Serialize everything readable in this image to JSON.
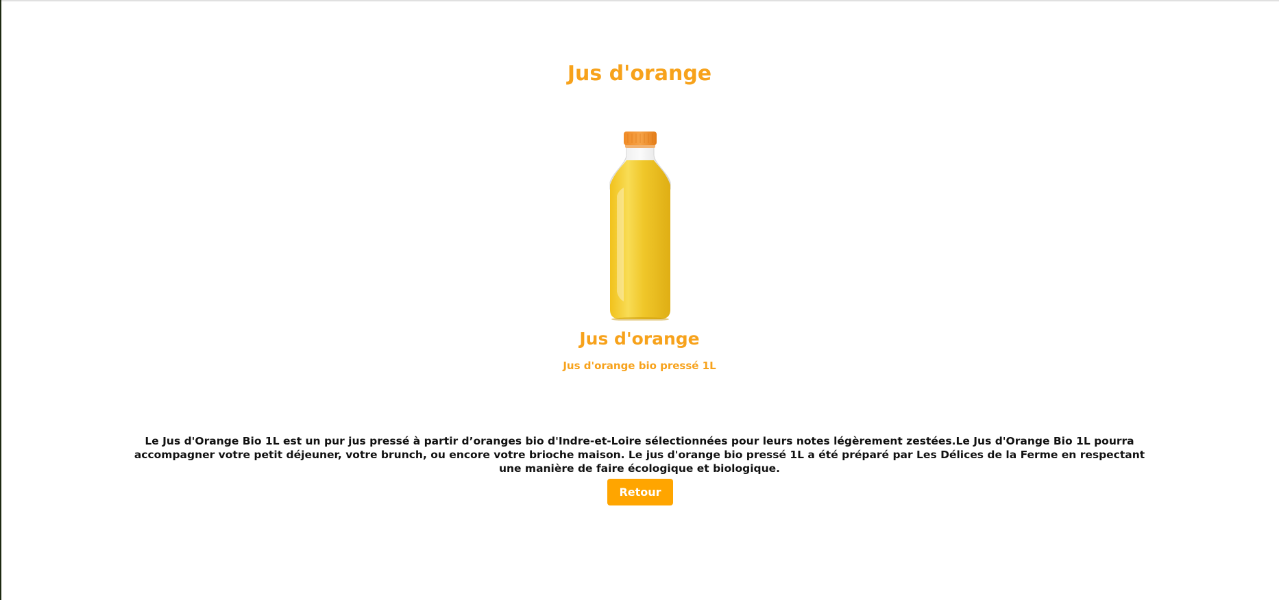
{
  "page": {
    "title": "Jus d'orange"
  },
  "product": {
    "image_alt": "Bouteille de jus d'orange",
    "name": "Jus d'orange",
    "subtitle": "Jus d'orange bio pressé 1L",
    "description": "Le Jus d'Orange Bio 1L est un pur jus pressé à partir d’oranges bio d'Indre-et-Loire sélectionnées pour leurs notes légèrement zestées.Le Jus d'Orange Bio 1L pourra accompagner votre petit déjeuner, votre brunch, ou encore votre brioche maison. Le jus d'orange bio pressé 1L a été préparé par Les Délices de la Ferme en respectant une manière de faire écologique et biologique."
  },
  "actions": {
    "back_label": "Retour"
  },
  "colors": {
    "accent": "#f7a21b",
    "button": "#ffa500",
    "text": "#111111",
    "background": "#ffffff"
  }
}
